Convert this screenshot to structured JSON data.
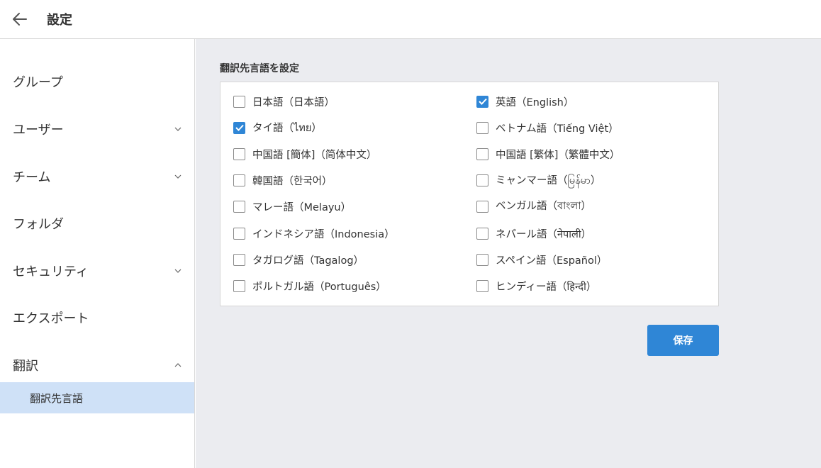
{
  "header": {
    "title": "設定",
    "back_icon": "arrow-left-icon"
  },
  "sidebar": {
    "items": [
      {
        "label": "グループ",
        "chevron": "none"
      },
      {
        "label": "ユーザー",
        "chevron": "down"
      },
      {
        "label": "チーム",
        "chevron": "down"
      },
      {
        "label": "フォルダ",
        "chevron": "none"
      },
      {
        "label": "セキュリティ",
        "chevron": "down"
      },
      {
        "label": "エクスポート",
        "chevron": "none"
      },
      {
        "label": "翻訳",
        "chevron": "up"
      }
    ],
    "sub_item": {
      "label": "翻訳先言語",
      "active": true
    }
  },
  "main": {
    "section_title": "翻訳先言語を設定",
    "languages": [
      {
        "label": "日本語（日本語）",
        "checked": false
      },
      {
        "label": "英語（English）",
        "checked": true
      },
      {
        "label": "タイ語（ไทย）",
        "checked": true
      },
      {
        "label": "ベトナム語（Tiếng Việt）",
        "checked": false
      },
      {
        "label": "中国語 [簡体]（简体中文）",
        "checked": false
      },
      {
        "label": "中国語 [繁体]（繁體中文）",
        "checked": false
      },
      {
        "label": "韓国語（한국어）",
        "checked": false
      },
      {
        "label": "ミャンマー語（မြန်မာ）",
        "checked": false
      },
      {
        "label": "マレー語（Melayu）",
        "checked": false
      },
      {
        "label": "ベンガル語（বাংলা）",
        "checked": false
      },
      {
        "label": "インドネシア語（Indonesia）",
        "checked": false
      },
      {
        "label": "ネパール語（नेपाली）",
        "checked": false
      },
      {
        "label": "タガログ語（Tagalog）",
        "checked": false
      },
      {
        "label": "スペイン語（Español）",
        "checked": false
      },
      {
        "label": "ポルトガル語（Português）",
        "checked": false
      },
      {
        "label": "ヒンディー語（हिन्दी）",
        "checked": false
      }
    ],
    "save_label": "保存"
  },
  "colors": {
    "accent": "#2f86d6",
    "active_bg": "#cfe1f7",
    "main_bg": "#ebecf0"
  }
}
